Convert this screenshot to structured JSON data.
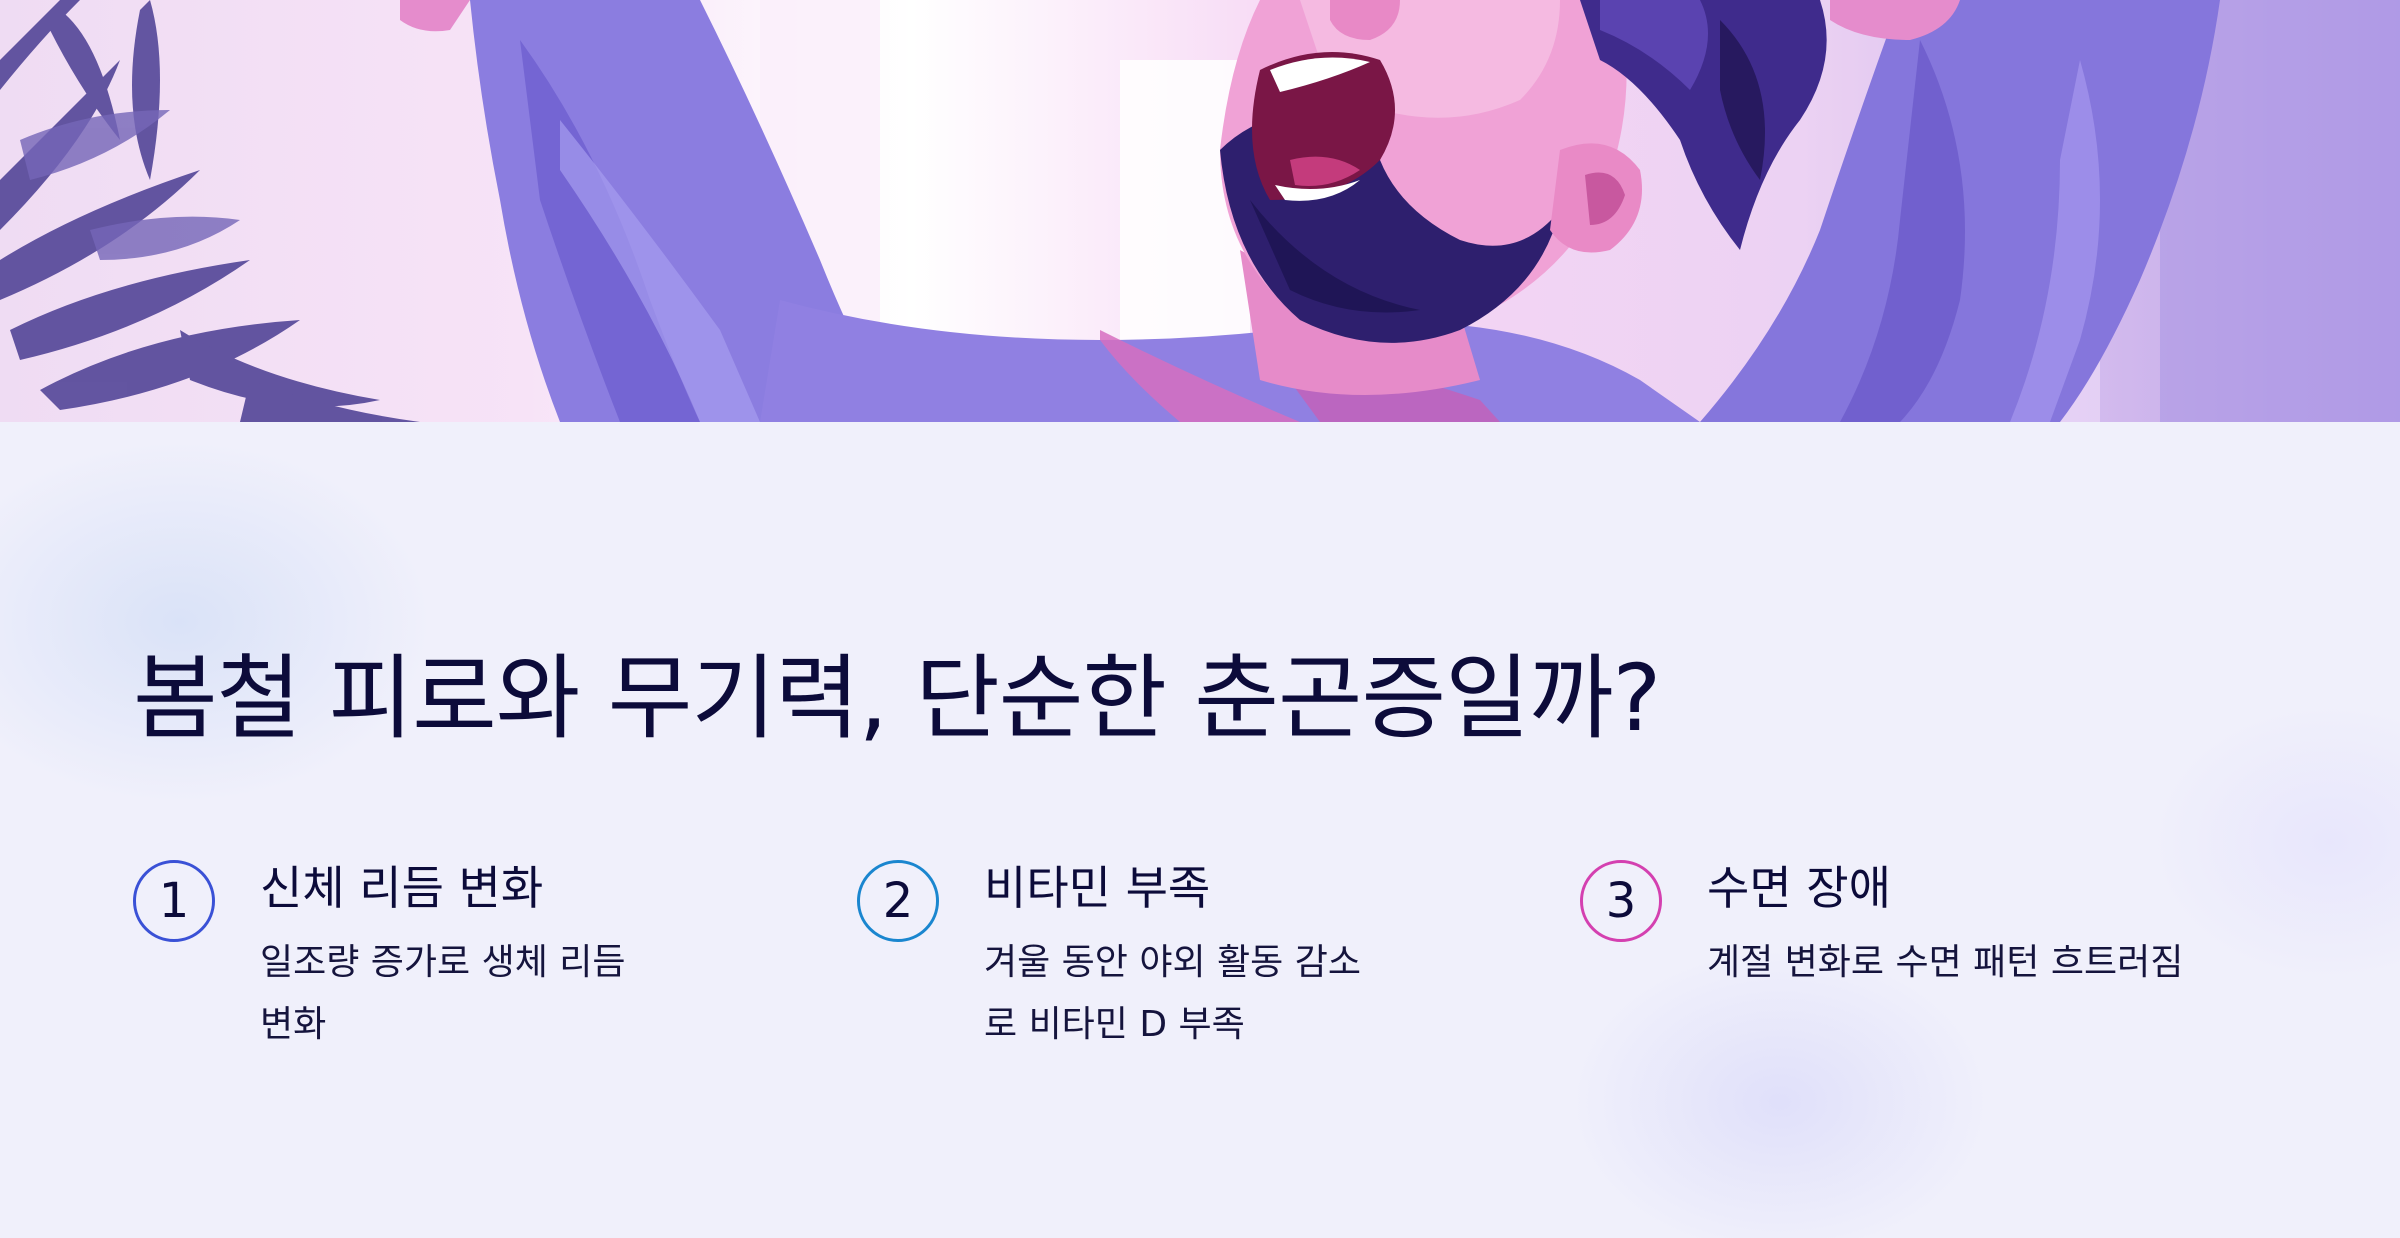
{
  "hero": {
    "illustration": "man-yawning-illustration"
  },
  "title": "봄철 피로와 무기력, 단순한 춘곤증일까?",
  "features": [
    {
      "number": "1",
      "title": "신체 리듬 변화",
      "description": "일조량 증가로 생체 리듬 변화",
      "accent": "#3a51d6"
    },
    {
      "number": "2",
      "title": "비타민 부족",
      "description": "겨울 동안 야외 활동 감소로 비타민 D 부족",
      "accent": "#1a86cf"
    },
    {
      "number": "3",
      "title": "수면 장애",
      "description": "계절 변화로 수면 패턴 흐트러짐",
      "accent": "#d440b0"
    }
  ]
}
